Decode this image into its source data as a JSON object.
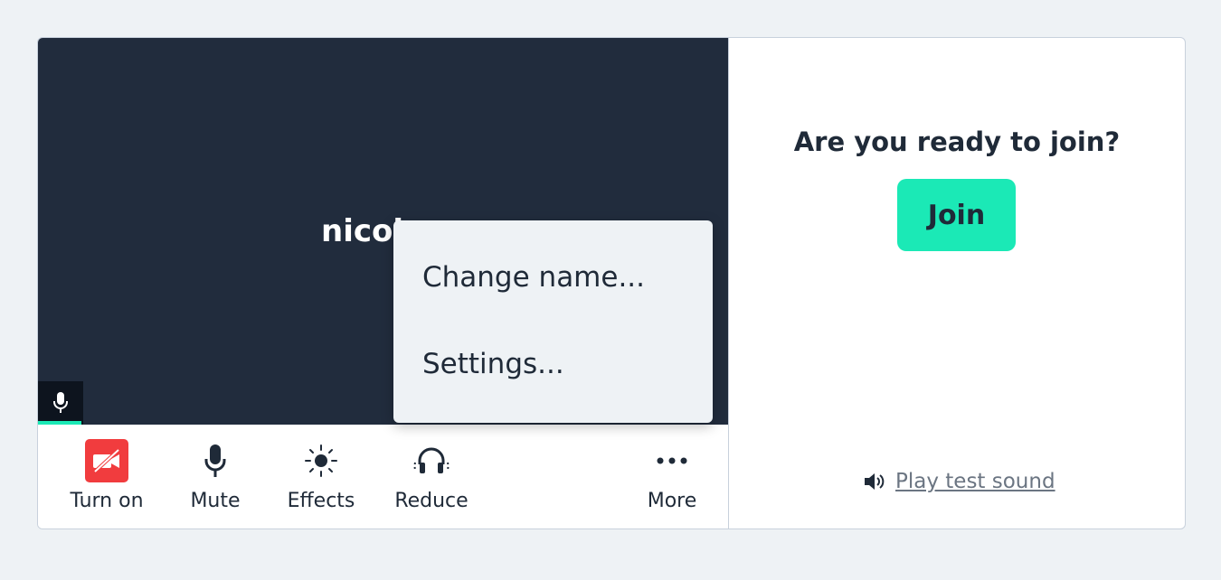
{
  "video": {
    "participant_name": "nicole"
  },
  "toolbar": {
    "camera_label": "Turn on",
    "mute_label": "Mute",
    "effects_label": "Effects",
    "reduce_label": "Reduce",
    "more_label": "More"
  },
  "menu": {
    "items": [
      {
        "label": "Change name..."
      },
      {
        "label": "Settings..."
      }
    ]
  },
  "join": {
    "title": "Are you ready to join?",
    "button_label": "Join",
    "test_sound_label": "Play test sound"
  },
  "colors": {
    "accent": "#1be9b6",
    "video_bg": "#212c3d",
    "camera_off": "#f13c3e",
    "page_bg": "#eef2f5"
  },
  "icons": {
    "camera": "video-camera-off-icon",
    "mic": "microphone-icon",
    "effects": "sun-icon",
    "reduce": "headphones-icon",
    "more": "more-dots-icon",
    "speaker": "speaker-icon"
  }
}
